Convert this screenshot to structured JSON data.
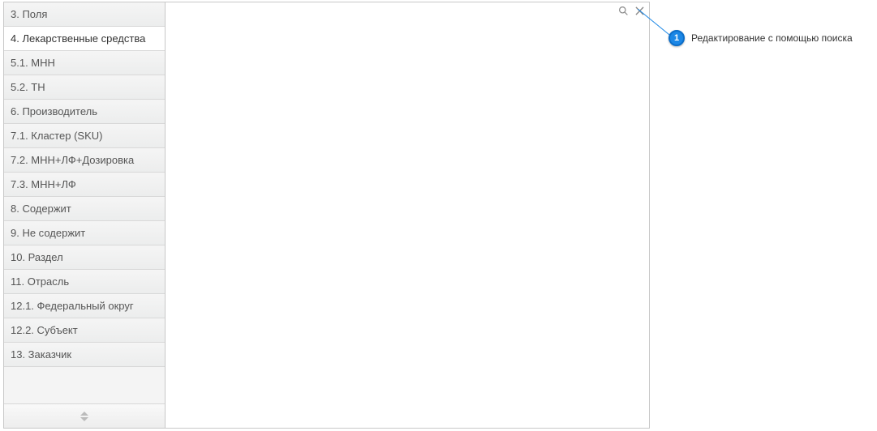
{
  "sidebar": {
    "items": [
      {
        "label": "3. Поля",
        "active": false
      },
      {
        "label": "4. Лекарственные средства",
        "active": true
      },
      {
        "label": "5.1. МНН",
        "active": false
      },
      {
        "label": "5.2. ТН",
        "active": false
      },
      {
        "label": "6. Производитель",
        "active": false
      },
      {
        "label": "7.1. Кластер (SKU)",
        "active": false
      },
      {
        "label": "7.2. МНН+ЛФ+Дозировка",
        "active": false
      },
      {
        "label": "7.3. МНН+ЛФ",
        "active": false
      },
      {
        "label": "8. Содержит",
        "active": false
      },
      {
        "label": "9. Не содержит",
        "active": false
      },
      {
        "label": "10. Раздел",
        "active": false
      },
      {
        "label": "11. Отрасль",
        "active": false
      },
      {
        "label": "12.1. Федеральный округ",
        "active": false
      },
      {
        "label": "12.2. Субъект",
        "active": false
      },
      {
        "label": "13. Заказчик",
        "active": false
      }
    ]
  },
  "toolbar": {
    "search_icon": "search",
    "close_icon": "close"
  },
  "callout": {
    "number": "1",
    "text": "Редактирование с помощью поиска"
  },
  "colors": {
    "accent": "#1b87e6",
    "accent_border": "#0c6ec9",
    "border": "#c8c8c8"
  }
}
